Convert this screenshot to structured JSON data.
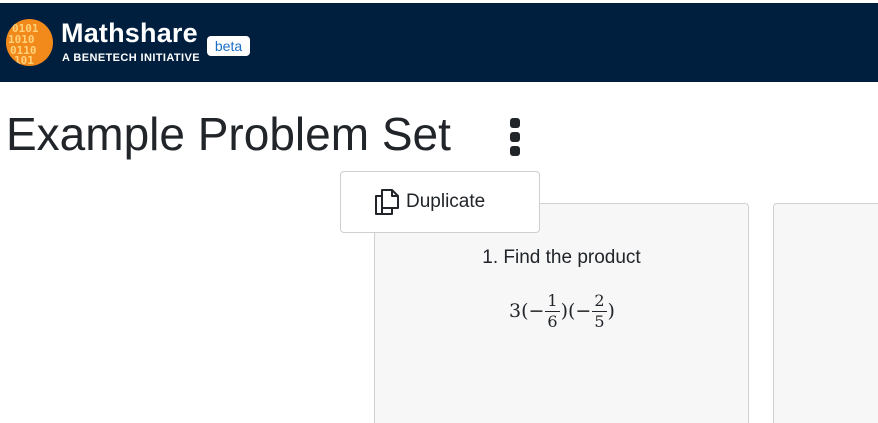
{
  "header": {
    "brand_name": "Mathshare",
    "brand_sub": "A BENETECH INITIATIVE",
    "beta_label": "beta",
    "logo_icon": "binary-digits-logo-icon",
    "bg_color": "#001f3f",
    "logo_color": "#f28a1b"
  },
  "page": {
    "title": "Example Problem Set",
    "menu_icon": "kebab-vertical-icon"
  },
  "dropdown": {
    "items": [
      {
        "label": "Duplicate",
        "icon": "copy-icon"
      }
    ]
  },
  "problems": [
    {
      "text": "1. Find the product",
      "expression": {
        "lead": "3(−",
        "frac1": {
          "num": "1",
          "den": "6"
        },
        "mid": ")(−",
        "frac2": {
          "num": "2",
          "den": "5"
        },
        "tail": ")"
      }
    }
  ]
}
